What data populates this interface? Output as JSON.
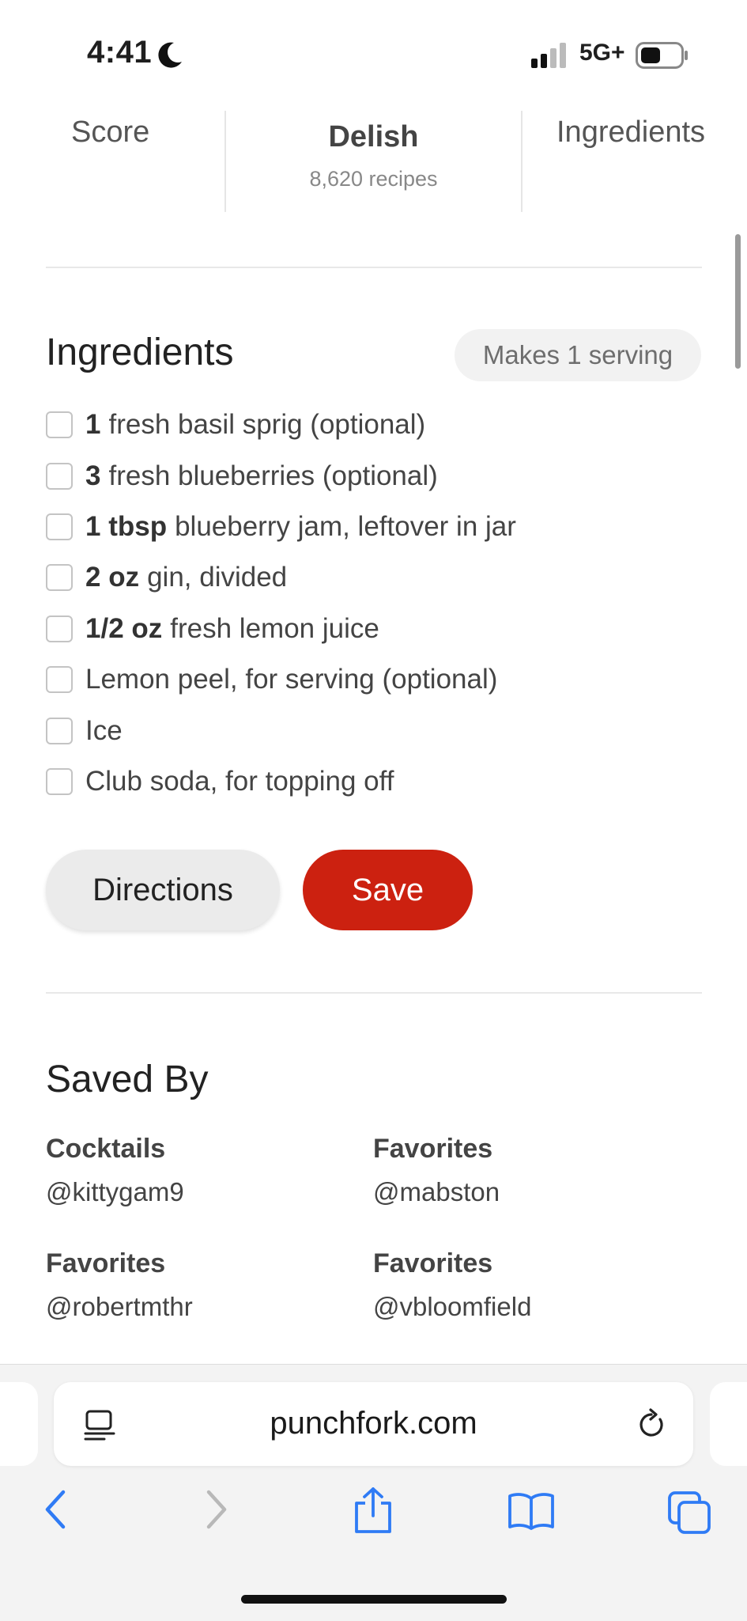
{
  "status_bar": {
    "time": "4:41",
    "network": "5G+"
  },
  "stats": {
    "score_label": "Score",
    "source_name": "Delish",
    "source_count": "8,620 recipes",
    "ingredients_label": "Ingredients"
  },
  "ingredients": {
    "title": "Ingredients",
    "serving": "Makes 1 serving",
    "items": [
      {
        "qty": "1",
        "text": "fresh basil sprig (optional)"
      },
      {
        "qty": "3",
        "text": "fresh blueberries (optional)"
      },
      {
        "qty": "1 tbsp",
        "text": "blueberry jam, leftover in jar"
      },
      {
        "qty": "2 oz",
        "text": "gin, divided"
      },
      {
        "qty": "1/2 oz",
        "text": "fresh lemon juice"
      },
      {
        "qty": "",
        "text": "Lemon peel, for serving (optional)"
      },
      {
        "qty": "",
        "text": "Ice"
      },
      {
        "qty": "",
        "text": "Club soda, for topping off"
      }
    ]
  },
  "actions": {
    "directions_label": "Directions",
    "save_label": "Save"
  },
  "saved_by": {
    "title": "Saved By",
    "entries": [
      {
        "collection": "Cocktails",
        "user": "@kittygam9"
      },
      {
        "collection": "Favorites",
        "user": "@mabston"
      },
      {
        "collection": "Favorites",
        "user": "@robertmthr"
      },
      {
        "collection": "Favorites",
        "user": "@vbloomfield"
      }
    ]
  },
  "browser": {
    "url": "punchfork.com"
  },
  "colors": {
    "accent": "#cc2110",
    "ios_blue": "#2f7bf5"
  }
}
